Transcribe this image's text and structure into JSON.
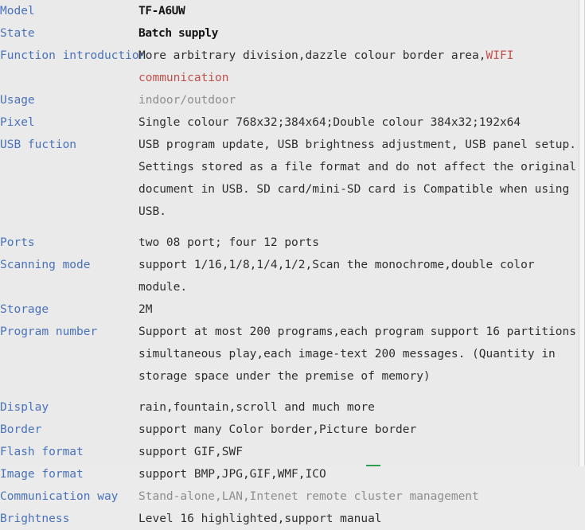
{
  "theme": {
    "background": "#eaeaea",
    "label_color": "#4a72b8",
    "value_color": "#2b2b2b",
    "muted_value_color": "#8e8e8e",
    "accent_red": "#c0504d",
    "accent_green": "#2e9e53"
  },
  "spec_sheet": {
    "rows": [
      {
        "label": "Model",
        "value": "TF-A6UW",
        "style": "strong"
      },
      {
        "label": "State",
        "value": "Batch supply",
        "style": "strong"
      },
      {
        "label": "Function introduction",
        "value_lead": "More arbitrary division,dazzle colour border area,",
        "value_accent": "WIFI communication",
        "style": "normal-with-accent"
      },
      {
        "label": "Usage",
        "value": "indoor/outdoor",
        "style": "muted"
      },
      {
        "label": "Pixel",
        "value": "Single colour 768x32;384x64;Double colour 384x32;192x64",
        "style": "normal"
      },
      {
        "label": "USB fuction",
        "value": "USB program update, USB brightness adjustment, USB panel setup. Settings stored as a file format and do not affect the original document in USB. SD card/mini-SD card is Compatible when using USB.",
        "style": "normal"
      },
      {
        "label": "Ports",
        "value": "two 08 port; four 12 ports",
        "style": "normal"
      },
      {
        "label": "Scanning mode",
        "value": "support 1/16,1/8,1/4,1/2,Scan the monochrome,double color module.",
        "style": "normal"
      },
      {
        "label": "Storage",
        "value": "2M",
        "style": "normal"
      },
      {
        "label": "Program number",
        "value": "Support at most 200 programs,each program support 16 partitions simultaneous play,each image-text 200 messages. (Quantity in storage space under the premise of memory)",
        "style": "normal"
      },
      {
        "label": "Display",
        "value": "rain,fountain,scroll and much more",
        "style": "normal"
      },
      {
        "label": "Border",
        "value": "support many Color border,Picture border",
        "style": "normal"
      },
      {
        "label": "Flash format",
        "value": "support GIF,SWF",
        "style": "normal"
      },
      {
        "label": "Image format",
        "value": "support BMP,JPG,GIF,WMF,ICO",
        "style": "normal"
      },
      {
        "label": "Communication way",
        "value": "Stand-alone,LAN,Intenet remote cluster management",
        "style": "muted"
      },
      {
        "label": "Brightness",
        "value": "Level 16 highlighted,support manual",
        "style": "normal"
      }
    ]
  }
}
